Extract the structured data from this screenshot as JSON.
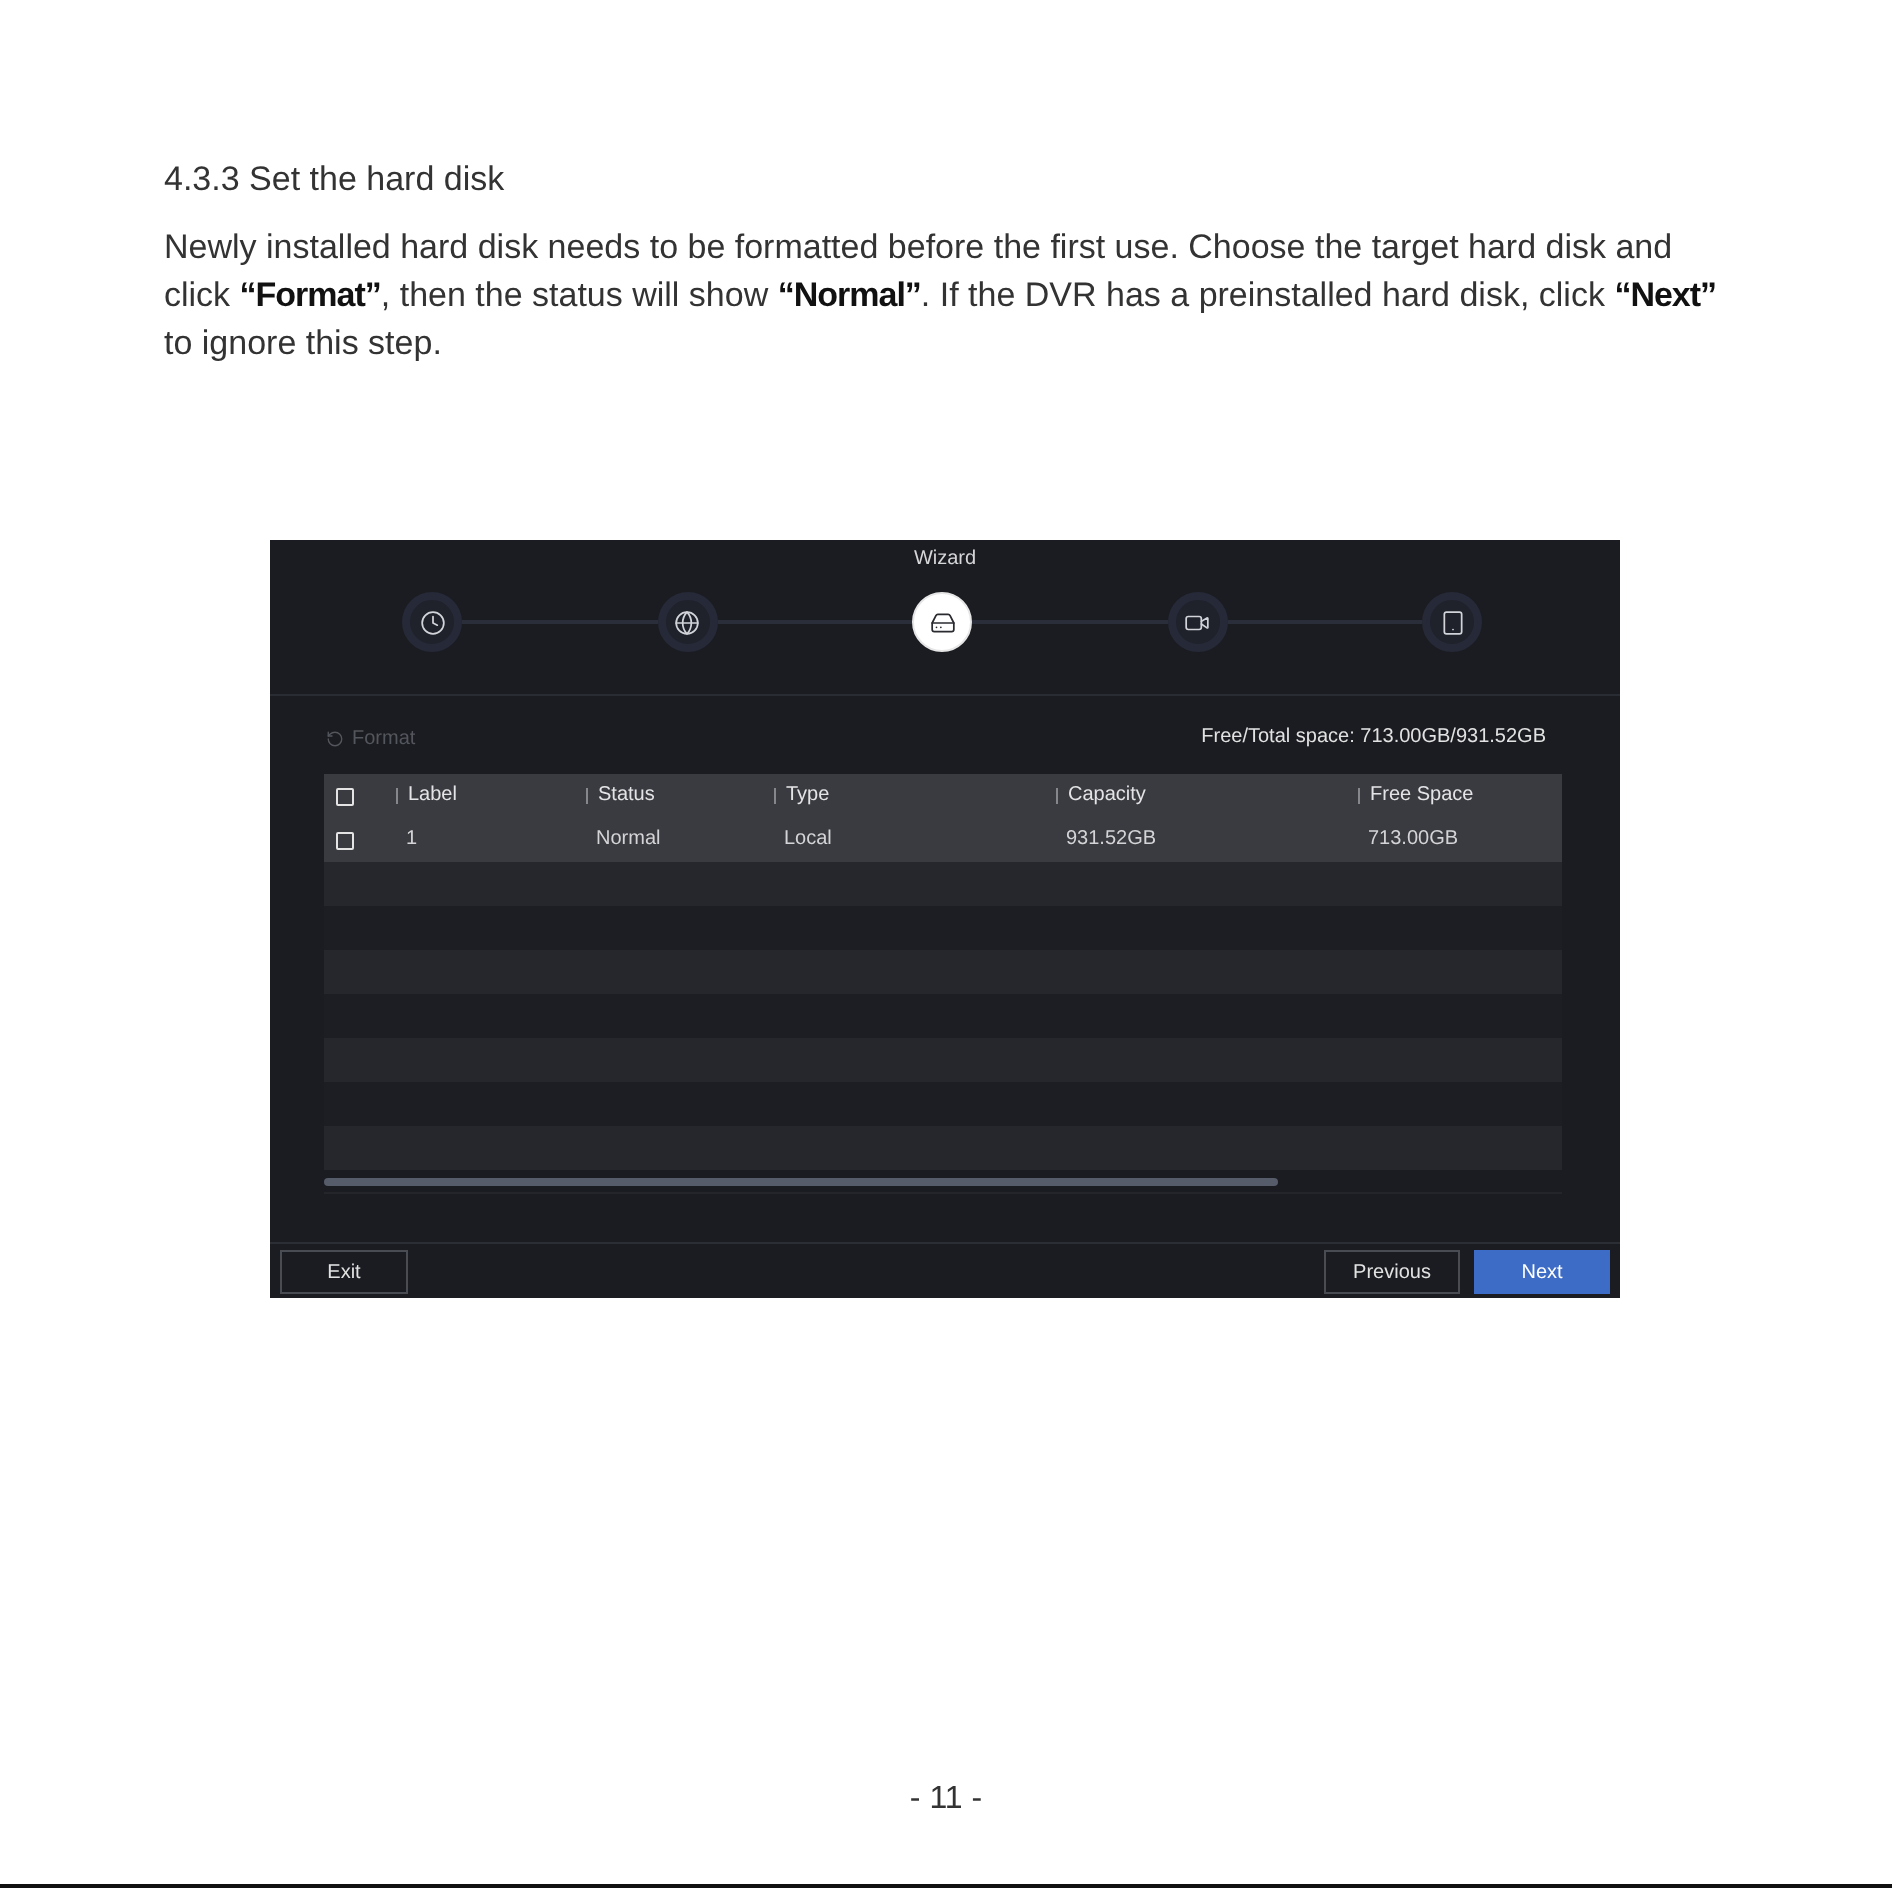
{
  "section_heading": "4.3.3 Set the hard disk",
  "instructions": "Newly installed hard disk needs to be formatted before the first use. Choose the target hard disk and click **“Format”**, then the status will show **“Normal”**. If the DVR has a preinstalled hard disk, click **“Next”** to ignore this step.",
  "wizard": {
    "title": "Wizard",
    "steps": [
      {
        "kind": "clock",
        "selected": false
      },
      {
        "kind": "globe",
        "selected": false
      },
      {
        "kind": "disk",
        "selected": true
      },
      {
        "kind": "camera",
        "selected": false
      },
      {
        "kind": "tablet",
        "selected": false
      }
    ],
    "format_button": {
      "label": "Format",
      "disabled": true
    },
    "space_summary": "Free/Total space: 713.00GB/931.52GB",
    "table": {
      "select_all": {
        "checked": false
      },
      "columns": [
        "Label",
        "Status",
        "Type",
        "Capacity",
        "Free Space"
      ],
      "rows": [
        {
          "checked": false,
          "selected": true,
          "cells": [
            "1",
            "Normal",
            "Local",
            "931.52GB",
            "713.00GB"
          ]
        }
      ]
    },
    "footer": {
      "left_buttons": [
        {
          "label": "Exit",
          "primary": false
        }
      ],
      "right_buttons": [
        {
          "label": "Previous",
          "primary": false
        },
        {
          "label": "Next",
          "primary": true
        }
      ]
    }
  },
  "page_number": "- 11 -"
}
